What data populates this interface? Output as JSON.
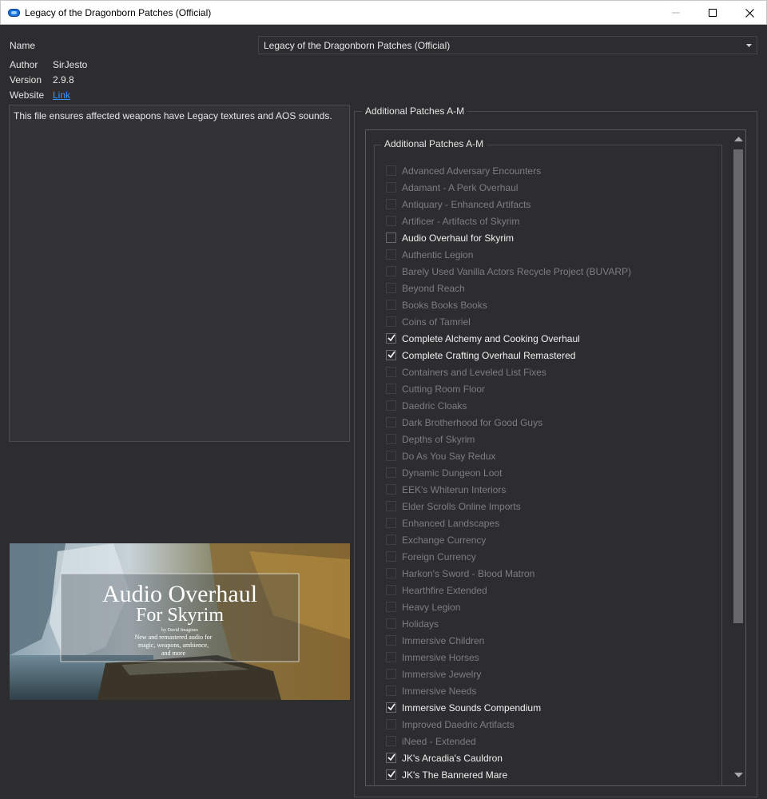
{
  "window": {
    "title": "Legacy of the Dragonborn Patches (Official)",
    "icon": "mo2-app-icon",
    "minimize_icon": "minimize-icon",
    "maximize_icon": "maximize-icon",
    "close_icon": "close-icon"
  },
  "info": {
    "name_label": "Name",
    "name_value": "Legacy of the Dragonborn Patches (Official)",
    "author_label": "Author",
    "author_value": "SirJesto",
    "version_label": "Version",
    "version_value": "2.9.8",
    "website_label": "Website",
    "website_value": "Link"
  },
  "description": "This file ensures affected weapons have Legacy textures and AOS sounds.",
  "banner": {
    "title_line1": "Audio Overhaul",
    "title_line2": "For Skyrim",
    "byline": "by David Imagines",
    "tagline1": "New and remastered audio for",
    "tagline2": "magic, weapons, ambience,",
    "tagline3": "and more"
  },
  "group": {
    "outer_title": "Additional Patches A-M",
    "inner_title": "Additional Patches A-M",
    "options": [
      {
        "label": "Advanced Adversary Encounters",
        "checked": false,
        "enabled": false
      },
      {
        "label": "Adamant - A Perk Overhaul",
        "checked": false,
        "enabled": false
      },
      {
        "label": "Antiquary - Enhanced Artifacts",
        "checked": false,
        "enabled": false
      },
      {
        "label": "Artificer - Artifacts of Skyrim",
        "checked": false,
        "enabled": false
      },
      {
        "label": "Audio Overhaul for Skyrim",
        "checked": false,
        "enabled": true
      },
      {
        "label": "Authentic Legion",
        "checked": false,
        "enabled": false
      },
      {
        "label": "Barely Used Vanilla Actors Recycle Project (BUVARP)",
        "checked": false,
        "enabled": false
      },
      {
        "label": "Beyond Reach",
        "checked": false,
        "enabled": false
      },
      {
        "label": "Books Books Books",
        "checked": false,
        "enabled": false
      },
      {
        "label": "Coins of Tamriel",
        "checked": false,
        "enabled": false
      },
      {
        "label": "Complete Alchemy and Cooking Overhaul",
        "checked": true,
        "enabled": true
      },
      {
        "label": "Complete Crafting Overhaul Remastered",
        "checked": true,
        "enabled": true
      },
      {
        "label": "Containers and Leveled List Fixes",
        "checked": false,
        "enabled": false
      },
      {
        "label": "Cutting Room Floor",
        "checked": false,
        "enabled": false
      },
      {
        "label": "Daedric Cloaks",
        "checked": false,
        "enabled": false
      },
      {
        "label": "Dark Brotherhood for Good Guys",
        "checked": false,
        "enabled": false
      },
      {
        "label": "Depths of Skyrim",
        "checked": false,
        "enabled": false
      },
      {
        "label": "Do As You Say Redux",
        "checked": false,
        "enabled": false
      },
      {
        "label": "Dynamic Dungeon Loot",
        "checked": false,
        "enabled": false
      },
      {
        "label": "EEK's Whiterun Interiors",
        "checked": false,
        "enabled": false
      },
      {
        "label": "Elder Scrolls Online Imports",
        "checked": false,
        "enabled": false
      },
      {
        "label": "Enhanced Landscapes",
        "checked": false,
        "enabled": false
      },
      {
        "label": "Exchange Currency",
        "checked": false,
        "enabled": false
      },
      {
        "label": "Foreign Currency",
        "checked": false,
        "enabled": false
      },
      {
        "label": "Harkon's Sword - Blood Matron",
        "checked": false,
        "enabled": false
      },
      {
        "label": "Hearthfire Extended",
        "checked": false,
        "enabled": false
      },
      {
        "label": "Heavy Legion",
        "checked": false,
        "enabled": false
      },
      {
        "label": "Holidays",
        "checked": false,
        "enabled": false
      },
      {
        "label": "Immersive Children",
        "checked": false,
        "enabled": false
      },
      {
        "label": "Immersive Horses",
        "checked": false,
        "enabled": false
      },
      {
        "label": "Immersive Jewelry",
        "checked": false,
        "enabled": false
      },
      {
        "label": "Immersive Needs",
        "checked": false,
        "enabled": false
      },
      {
        "label": "Immersive Sounds Compendium",
        "checked": true,
        "enabled": true
      },
      {
        "label": "Improved Daedric Artifacts",
        "checked": false,
        "enabled": false
      },
      {
        "label": "iNeed - Extended",
        "checked": false,
        "enabled": false
      },
      {
        "label": "JK's Arcadia's Cauldron",
        "checked": true,
        "enabled": true
      },
      {
        "label": "JK's The Bannered Mare",
        "checked": true,
        "enabled": true
      }
    ]
  },
  "colors": {
    "background": "#2d2d30",
    "link": "#3794ff",
    "disabled_text": "#7d7d82",
    "enabled_text": "#f0f0f0"
  }
}
